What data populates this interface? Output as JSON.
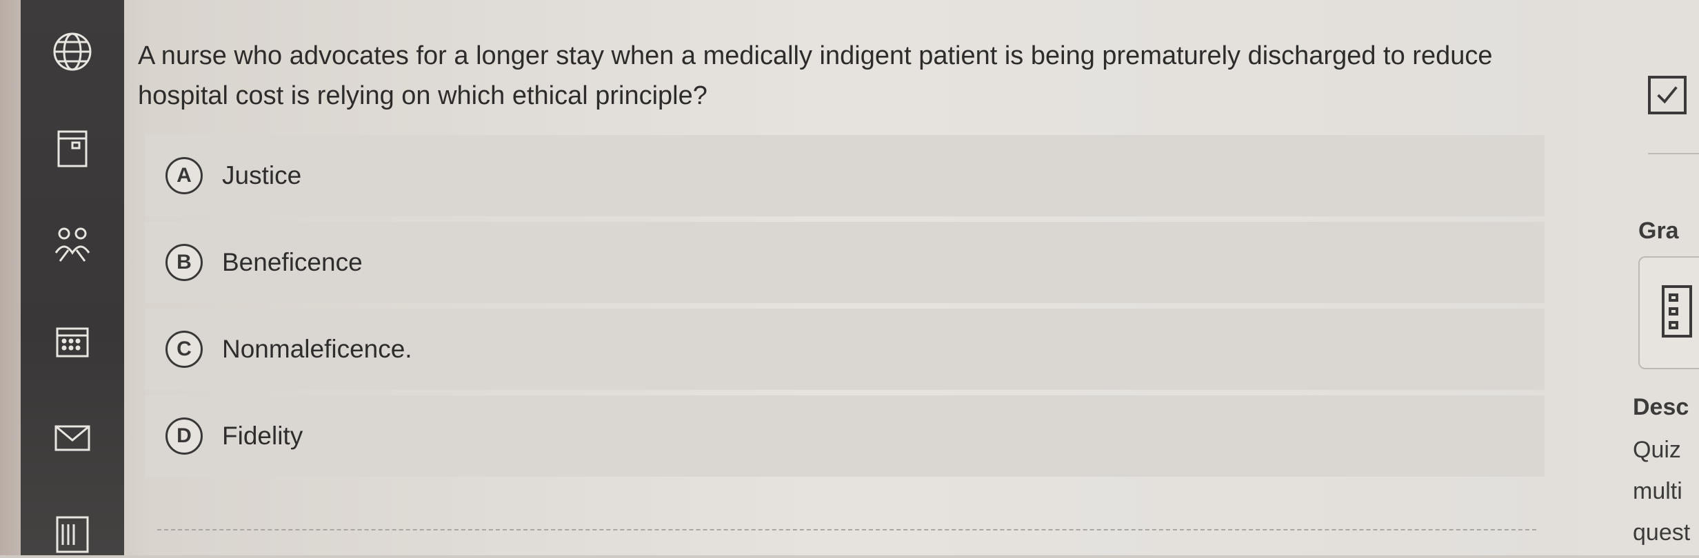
{
  "question": {
    "text_line1": "A nurse who advocates for a longer stay when a medically indigent patient is being prematurely discharged to reduce",
    "text_line2": "hospital cost is relying on which ethical principle?"
  },
  "options": [
    {
      "letter": "A",
      "label": "Justice"
    },
    {
      "letter": "B",
      "label": "Beneficence"
    },
    {
      "letter": "C",
      "label": "Nonmaleficence."
    },
    {
      "letter": "D",
      "label": "Fidelity"
    }
  ],
  "left_rail": {
    "icons": [
      "globe-icon",
      "calendar-icon",
      "people-icon",
      "grid-calendar-icon",
      "mail-icon",
      "list-icon"
    ]
  },
  "right_panel": {
    "grade_heading": "Gra",
    "description_heading": "Desc",
    "description_lines": [
      "Quiz",
      "multi",
      "quest"
    ]
  },
  "colors": {
    "rail": "#3d3b3b",
    "option_bg": "#dad7d3",
    "text": "#2e2c2b"
  }
}
